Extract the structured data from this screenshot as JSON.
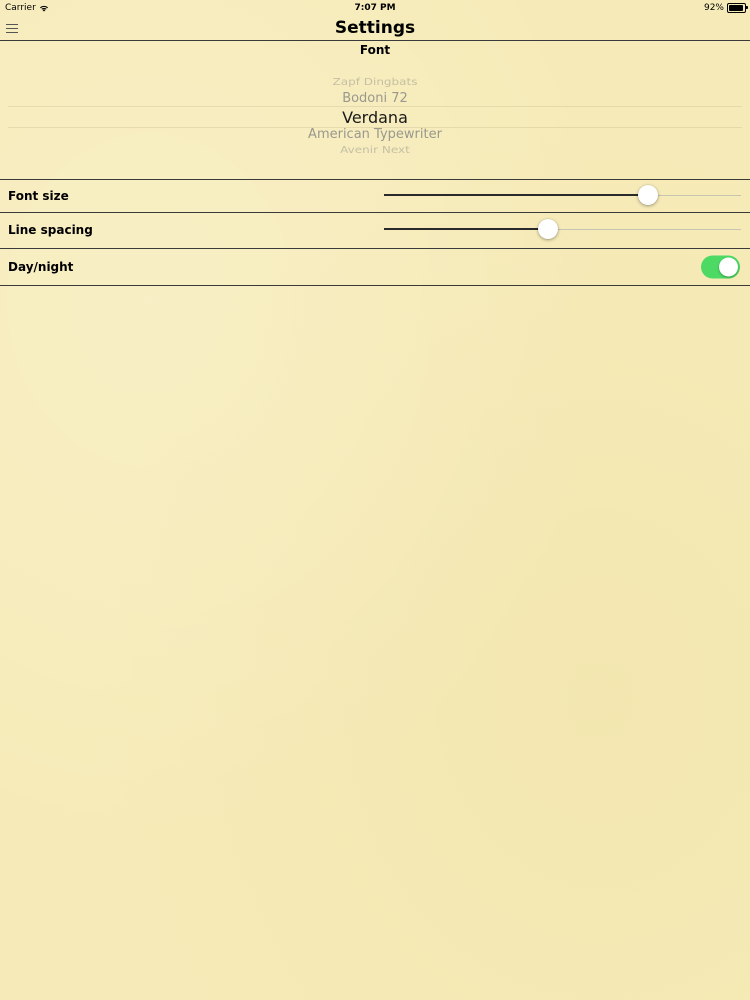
{
  "status_bar": {
    "carrier": "Carrier",
    "time": "7:07 PM",
    "battery_text": "92%",
    "battery_level": 0.92,
    "wifi_icon": "wifi-icon",
    "battery_icon": "battery-icon"
  },
  "nav": {
    "title": "Settings",
    "menu_icon": "hamburger-menu-icon"
  },
  "font_picker": {
    "title": "Font",
    "items": [
      "Zapf Dingbats",
      "Bodoni 72",
      "Verdana",
      "American Typewriter",
      "Avenir Next"
    ],
    "selected": "Verdana"
  },
  "settings": {
    "font_size": {
      "label": "Font size",
      "value": 0.74
    },
    "line_spacing": {
      "label": "Line spacing",
      "value": 0.46
    },
    "day_night": {
      "label": "Day/night",
      "on": true
    }
  },
  "colors": {
    "background": "#f6ebb8",
    "toggle_on": "#4cd964",
    "slider_fill": "#2a2a2a"
  }
}
